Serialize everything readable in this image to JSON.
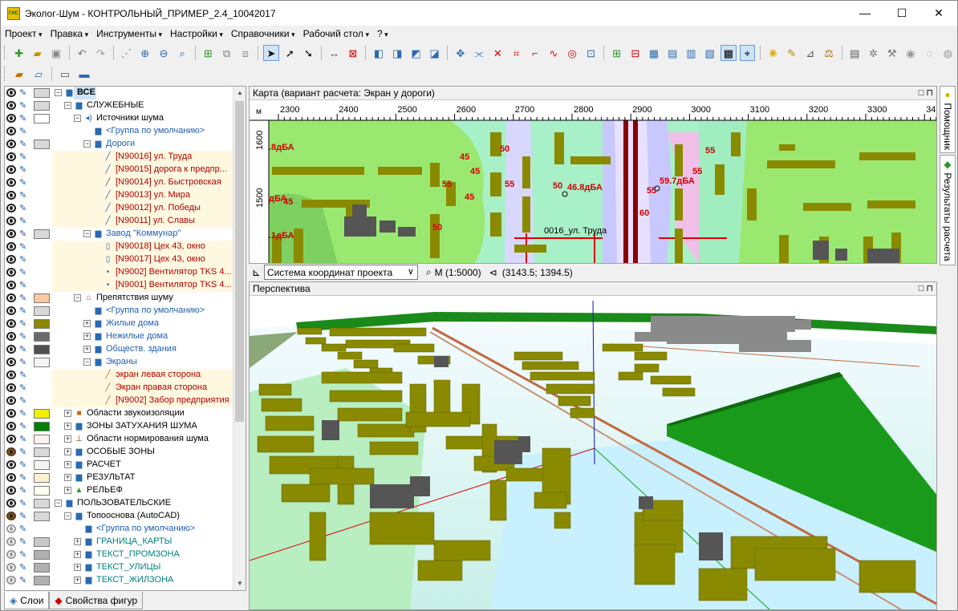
{
  "window": {
    "title": "Эколог-Шум - КОНТРОЛЬНЫЙ_ПРИМЕР_2.4_10042017",
    "app_icon_text": "ГИС",
    "minimize": "—",
    "maximize": "☐",
    "close": "✕"
  },
  "menu": [
    "Проект",
    "Правка",
    "Инструменты",
    "Настройки",
    "Справочники",
    "Рабочий стол",
    "?"
  ],
  "layers": [
    {
      "label": "ВСЕ",
      "indent": 0,
      "exp": "−",
      "icon": "folder",
      "swatch": "#d8d8d8",
      "eye": "normal",
      "bold": true,
      "selected": true,
      "color": "#000"
    },
    {
      "label": "СЛУЖЕБНЫЕ",
      "indent": 1,
      "exp": "−",
      "icon": "folder",
      "swatch": "#d8d8d8",
      "eye": "normal",
      "color": "#000"
    },
    {
      "label": "Источники шума",
      "indent": 2,
      "exp": "−",
      "icon": "speaker",
      "swatch": "#ffffff",
      "eye": "normal",
      "color": "#000"
    },
    {
      "label": "<Группа по умолчанию>",
      "indent": 3,
      "exp": "",
      "icon": "group",
      "swatch": "",
      "eye": "normal",
      "color": "#1f5fb0"
    },
    {
      "label": "Дороги",
      "indent": 3,
      "exp": "−",
      "icon": "group",
      "swatch": "#d8d8d8",
      "eye": "normal",
      "color": "#1f5fb0"
    },
    {
      "label": "[N90016] ул. Труда",
      "indent": 4,
      "exp": "",
      "icon": "road",
      "swatch": "",
      "eye": "normal",
      "color": "#b00000",
      "bg": "#fff8e0"
    },
    {
      "label": "[N90015] дорога к предпр...",
      "indent": 4,
      "exp": "",
      "icon": "road",
      "swatch": "",
      "eye": "normal",
      "color": "#b00000",
      "bg": "#fff8e0"
    },
    {
      "label": "[N90014] ул. Быстровская",
      "indent": 4,
      "exp": "",
      "icon": "road",
      "swatch": "",
      "eye": "normal",
      "color": "#b00000",
      "bg": "#fff8e0"
    },
    {
      "label": "[N90013] ул. Мира",
      "indent": 4,
      "exp": "",
      "icon": "road",
      "swatch": "",
      "eye": "normal",
      "color": "#b00000",
      "bg": "#fff8e0"
    },
    {
      "label": "[N90012] ул. Победы",
      "indent": 4,
      "exp": "",
      "icon": "road",
      "swatch": "",
      "eye": "normal",
      "color": "#b00000",
      "bg": "#fff8e0"
    },
    {
      "label": "[N90011] ул. Славы",
      "indent": 4,
      "exp": "",
      "icon": "road",
      "swatch": "",
      "eye": "normal",
      "color": "#b00000",
      "bg": "#fff8e0"
    },
    {
      "label": "Завод \"Коммунар\"",
      "indent": 3,
      "exp": "−",
      "icon": "group",
      "swatch": "#d8d8d8",
      "eye": "normal",
      "color": "#1f5fb0"
    },
    {
      "label": "[N90018] Цех 43, окно",
      "indent": 4,
      "exp": "",
      "icon": "window",
      "swatch": "",
      "eye": "normal",
      "color": "#b00000",
      "bg": "#fff8e0"
    },
    {
      "label": "[N90017] Цех 43, окно",
      "indent": 4,
      "exp": "",
      "icon": "window",
      "swatch": "",
      "eye": "normal",
      "color": "#b00000",
      "bg": "#fff8e0"
    },
    {
      "label": "[N9002] Вентилятор TKS 4...",
      "indent": 4,
      "exp": "",
      "icon": "point",
      "swatch": "",
      "eye": "normal",
      "color": "#b00000",
      "bg": "#fff8e0"
    },
    {
      "label": "[N9001] Вентилятор TKS 4...",
      "indent": 4,
      "exp": "",
      "icon": "point",
      "swatch": "",
      "eye": "normal",
      "color": "#b00000",
      "bg": "#fff8e0"
    },
    {
      "label": "Препятствия шуму",
      "indent": 2,
      "exp": "−",
      "icon": "house",
      "swatch": "#f8c8a0",
      "eye": "normal",
      "color": "#000"
    },
    {
      "label": "<Группа по умолчанию>",
      "indent": 3,
      "exp": "",
      "icon": "group",
      "swatch": "#d8d8d8",
      "eye": "normal",
      "color": "#1f5fb0"
    },
    {
      "label": "Жилые дома",
      "indent": 3,
      "exp": "+",
      "icon": "group",
      "swatch": "#8a8a00",
      "eye": "normal",
      "color": "#1f5fb0"
    },
    {
      "label": "Нежилые дома",
      "indent": 3,
      "exp": "+",
      "icon": "group",
      "swatch": "#6a6a6a",
      "eye": "normal",
      "color": "#1f5fb0"
    },
    {
      "label": "Обществ. здания",
      "indent": 3,
      "exp": "+",
      "icon": "group",
      "swatch": "#505050",
      "eye": "normal",
      "color": "#1f5fb0"
    },
    {
      "label": "Экраны",
      "indent": 3,
      "exp": "−",
      "icon": "group",
      "swatch": "#f4f4f4",
      "eye": "normal",
      "color": "#1f5fb0"
    },
    {
      "label": "экран левая сторона",
      "indent": 4,
      "exp": "",
      "icon": "screen",
      "swatch": "",
      "eye": "normal",
      "color": "#b00000",
      "bg": "#fff8e0"
    },
    {
      "label": "Экран правая сторона",
      "indent": 4,
      "exp": "",
      "icon": "screen",
      "swatch": "",
      "eye": "normal",
      "color": "#b00000",
      "bg": "#fff8e0"
    },
    {
      "label": "[N9002] Забор предприятия",
      "indent": 4,
      "exp": "",
      "icon": "screen",
      "swatch": "",
      "eye": "normal",
      "color": "#b00000",
      "bg": "#fff8e0"
    },
    {
      "label": "Области звукоизоляции",
      "indent": 1,
      "exp": "+",
      "icon": "cube",
      "swatch": "#f0f000",
      "eye": "normal",
      "color": "#000"
    },
    {
      "label": "ЗОНЫ ЗАТУХАНИЯ ШУМА",
      "indent": 1,
      "exp": "+",
      "icon": "folder",
      "swatch": "#008000",
      "eye": "normal",
      "color": "#000"
    },
    {
      "label": "Области нормирования шума",
      "indent": 1,
      "exp": "+",
      "icon": "norm",
      "swatch": "#fff0f0",
      "eye": "normal",
      "color": "#000"
    },
    {
      "label": "ОСОБЫЕ ЗОНЫ",
      "indent": 1,
      "exp": "+",
      "icon": "folder",
      "swatch": "#d8d8d8",
      "eye": "brown",
      "color": "#000"
    },
    {
      "label": "РАСЧЕТ",
      "indent": 1,
      "exp": "+",
      "icon": "folder",
      "swatch": "#f4f4f4",
      "eye": "normal",
      "color": "#000"
    },
    {
      "label": "РЕЗУЛЬТАТ",
      "indent": 1,
      "exp": "+",
      "icon": "folder",
      "swatch": "#fff0d0",
      "eye": "normal",
      "color": "#000"
    },
    {
      "label": "РЕЛЬЕФ",
      "indent": 1,
      "exp": "+",
      "icon": "relief",
      "swatch": "#fffff0",
      "eye": "normal",
      "color": "#000"
    },
    {
      "label": "ПОЛЬЗОВАТЕЛЬСКИЕ",
      "indent": 0,
      "exp": "−",
      "icon": "folder",
      "swatch": "#d8d8d8",
      "eye": "normal",
      "color": "#000"
    },
    {
      "label": "Топооснова (AutoCAD)",
      "indent": 1,
      "exp": "−",
      "icon": "folder",
      "swatch": "#d8d8d8",
      "eye": "brown",
      "color": "#000"
    },
    {
      "label": "<Группа по умолчанию>",
      "indent": 2,
      "exp": "",
      "icon": "group",
      "swatch": "",
      "eye": "gray",
      "color": "#1f5fb0"
    },
    {
      "label": "ГРАНИЦА_КАРТЫ",
      "indent": 2,
      "exp": "+",
      "icon": "group",
      "swatch": "#c8c8c8",
      "eye": "gray",
      "color": "#008080"
    },
    {
      "label": "ТЕКСТ_ПРОМЗОНА",
      "indent": 2,
      "exp": "+",
      "icon": "group",
      "swatch": "#b0b0b0",
      "eye": "gray",
      "color": "#008080"
    },
    {
      "label": "ТЕКСТ_УЛИЦЫ",
      "indent": 2,
      "exp": "+",
      "icon": "group",
      "swatch": "#b0b0b0",
      "eye": "gray",
      "color": "#008080"
    },
    {
      "label": "ТЕКСТ_ЖИЛЗОНА",
      "indent": 2,
      "exp": "+",
      "icon": "group",
      "swatch": "#b0b0b0",
      "eye": "gray",
      "color": "#008080"
    }
  ],
  "left_tabs": [
    "Слои",
    "Свойства фигур"
  ],
  "map": {
    "title": "Карта (вариант расчета: Экран у дороги)",
    "unit": "м",
    "x_ticks": [
      "2300",
      "2400",
      "2500",
      "2600",
      "2700",
      "2800",
      "2900",
      "3000",
      "3100",
      "3200",
      "3300",
      "34"
    ],
    "y_ticks": [
      "1600",
      "1500"
    ],
    "labels": [
      {
        "text": ".8дБА"
      },
      {
        "text": "45"
      },
      {
        "text": "50"
      },
      {
        "text": "55"
      },
      {
        "text": "50"
      },
      {
        "text": "46.8дБА"
      },
      {
        "text": "59.7дБА"
      },
      {
        "text": "55"
      },
      {
        "text": "60"
      },
      {
        "text": "55"
      },
      {
        "text": "дБА"
      },
      {
        "text": "45"
      },
      {
        "text": ".1дБА"
      },
      {
        "text": "50"
      },
      {
        "text": "45"
      },
      {
        "text": "45"
      },
      {
        "text": "55"
      },
      {
        "text": "55"
      }
    ],
    "road_label": "0016_ул. Труда"
  },
  "status": {
    "coord_system": "Система координат проекта",
    "scale": "М (1:5000)",
    "coords": "(3143.5; 1394.5)"
  },
  "perspective": {
    "title": "Перспектива"
  },
  "side_tabs": [
    "Помощник",
    "Результаты расчета"
  ]
}
